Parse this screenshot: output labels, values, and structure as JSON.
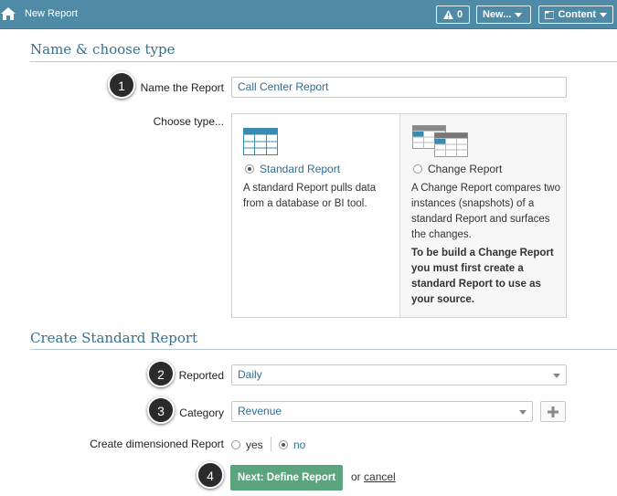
{
  "topbar": {
    "title": "New Report",
    "alert_label": "0",
    "new_label": "New...",
    "content_label": "Content",
    "bg_color": "#4f8ba7"
  },
  "section1": {
    "title": "Name & choose type",
    "name_label": "Name the Report",
    "name_value": "Call Center Report",
    "type_label": "Choose type...",
    "standard": {
      "label": "Standard Report",
      "selected": true,
      "description": "A standard Report pulls data from a database or BI tool."
    },
    "change": {
      "label": "Change Report",
      "selected": false,
      "description": "A Change Report compares two instances (snapshots) of a standard Report and surfaces the changes.",
      "note": "To be build a Change Report you must first create a standard Report to use as your source."
    }
  },
  "section2": {
    "title": "Create Standard Report",
    "reported_label": "Reported",
    "reported_value": "Daily",
    "category_label": "Category",
    "category_value": "Revenue",
    "dimensioned_label": "Create dimensioned Report",
    "yes_label": "yes",
    "no_label": "no",
    "next_label": "Next: Define Report",
    "or_text": "or",
    "cancel_label": "cancel"
  },
  "badges": [
    "1",
    "2",
    "3",
    "4"
  ],
  "icons": {
    "home": "home-icon",
    "alert": "warning-triangle-icon",
    "content": "window-icon",
    "add": "plus-icon",
    "standard": "table-icon",
    "change": "stacked-tables-icon"
  }
}
